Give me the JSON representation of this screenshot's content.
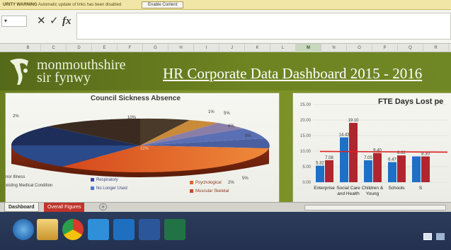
{
  "security_bar": {
    "warning": "URITY WARNING",
    "message": "Automatic update of links has been disabled",
    "enable_button": "Enable Content"
  },
  "formula_bar": {
    "cancel_glyph": "✕",
    "enter_glyph": "✓",
    "fx_glyph": "fx",
    "value": ""
  },
  "columns": [
    "B",
    "C",
    "D",
    "E",
    "F",
    "G",
    "H",
    "I",
    "J",
    "K",
    "L",
    "M",
    "N",
    "O",
    "P",
    "Q",
    "R"
  ],
  "selected_column": "M",
  "dashboard": {
    "org_line1": "monmouthshire",
    "org_line2": "sir fynwy",
    "title": "HR Corporate Data Dashboard 2015 - 2016"
  },
  "pie_chart": {
    "title": "Council Sickness Absence",
    "slice_labels": [
      "2%",
      "10%",
      "1%",
      "5%",
      "6%",
      "9%",
      "2%",
      "5%",
      "32%"
    ],
    "legend": [
      {
        "label": "Respiratory",
        "color": "#3f4a9e"
      },
      {
        "label": "No Longer Used",
        "color": "#4c78c8"
      },
      {
        "label": "Psychological",
        "color": "#e0662a"
      },
      {
        "label": "Muscular Skeletal",
        "color": "#c94a22"
      }
    ],
    "side_labels": [
      "nor Illness",
      "xisting Medical Condition"
    ]
  },
  "chart_data": {
    "type": "bar",
    "title": "FTE Days Lost pe",
    "categories": [
      "Enterprise",
      "Social Care and Health",
      "Children & Young",
      "Schools",
      ""
    ],
    "series": [
      {
        "values": [
          5.32,
          14.43,
          7.05,
          6.47,
          8.3
        ],
        "color": "#1f6fc8"
      },
      {
        "values": [
          7.08,
          19.1,
          9.4,
          8.62,
          8.3
        ],
        "color": "#b0262e"
      }
    ],
    "value_labels": [
      [
        "5.32",
        "14.43",
        "7.05",
        "6.47",
        ""
      ],
      [
        "7.08",
        "19.10",
        "9.40",
        "8.62",
        "8.30"
      ]
    ],
    "cat_labels": [
      "Enterprise",
      "Social Care",
      "Children &",
      "Schools",
      "S"
    ],
    "cat_labels2": [
      "",
      "and Health",
      "Young",
      "",
      ""
    ],
    "yticks": [
      "0.00",
      "5.00",
      "10.00",
      "15.00",
      "20.00",
      "25.00"
    ],
    "ylim": [
      0,
      25
    ],
    "reference_line": 9.9,
    "reference_color": "#e02020"
  },
  "sheet_tabs": [
    {
      "label": "Dashboard",
      "active": true
    },
    {
      "label": "Overall Figures",
      "active": false
    }
  ],
  "add_sheet_glyph": "+",
  "taskbar": {
    "icons": [
      "ie-icon",
      "explorer-icon",
      "chrome-icon",
      "skype-icon",
      "outlook-icon",
      "word-icon",
      "excel-icon"
    ]
  }
}
